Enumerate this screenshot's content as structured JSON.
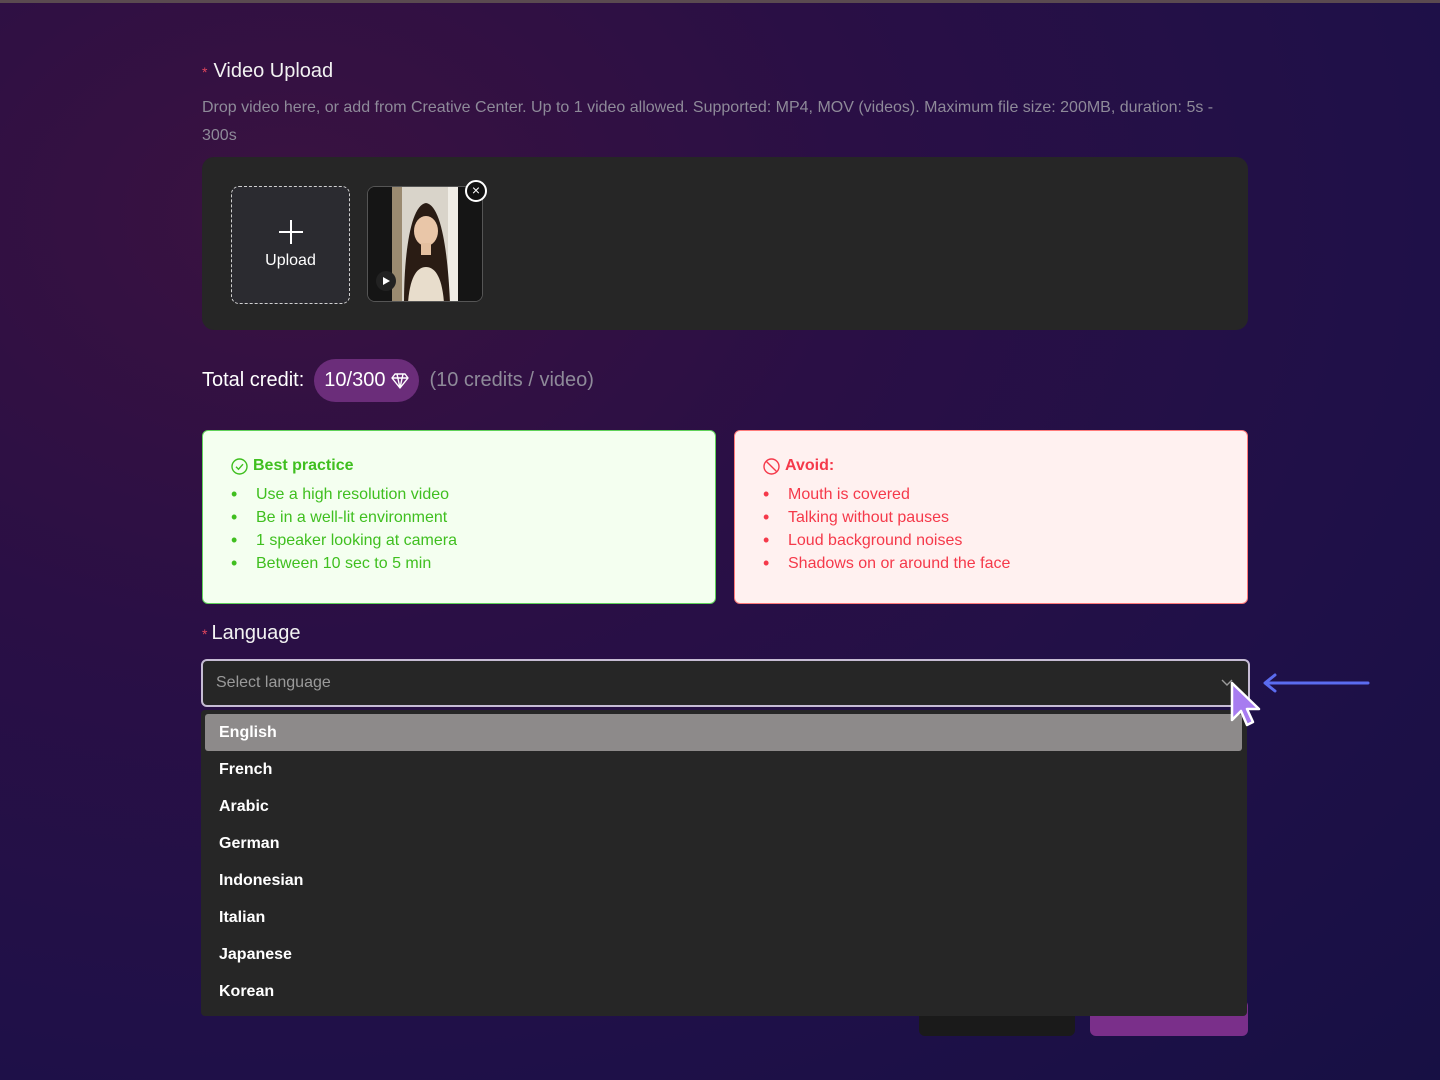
{
  "video_upload": {
    "required_mark": "*",
    "label": "Video Upload",
    "hint": "Drop video here, or add from Creative Center. Up to 1 video allowed. Supported: MP4, MOV (videos). Maximum file size: 200MB, duration: 5s - 300s",
    "upload_button": "Upload",
    "remove_symbol": "×"
  },
  "credit": {
    "label": "Total credit:",
    "value": "10/300",
    "note": "(10 credits / video)"
  },
  "best_practice": {
    "title": "Best practice",
    "items": [
      "Use a high resolution video",
      "Be in a well-lit environment",
      "1 speaker looking at camera",
      "Between 10 sec to 5 min"
    ]
  },
  "avoid": {
    "title": "Avoid:",
    "items": [
      "Mouth is covered",
      "Talking without pauses",
      "Loud background noises",
      "Shadows on or around the face"
    ]
  },
  "language": {
    "required_mark": "*",
    "label": "Language",
    "placeholder": "Select language",
    "options": [
      "English",
      "French",
      "Arabic",
      "German",
      "Indonesian",
      "Italian",
      "Japanese",
      "Korean"
    ],
    "highlighted": "English"
  },
  "colors": {
    "accent": "#6b2d7a",
    "success": "#3fbf1f",
    "danger": "#f5394a",
    "pointer_arrow": "#5b6cf0"
  },
  "icons": [
    "plus-icon",
    "play-icon",
    "close-icon",
    "diamond-icon",
    "check-circle-icon",
    "ban-icon",
    "chevron-down-icon",
    "arrow-left-icon",
    "mouse-cursor-icon"
  ]
}
